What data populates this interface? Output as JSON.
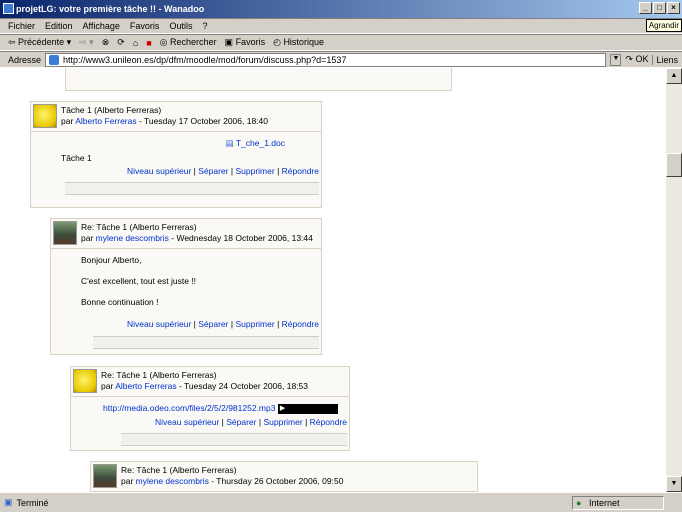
{
  "window": {
    "title": "projetLG: votre première tâche !! - Wanadoo",
    "tooltip": "Agrandir"
  },
  "menu": [
    "Fichier",
    "Edition",
    "Affichage",
    "Favoris",
    "Outils",
    "?"
  ],
  "toolbar": {
    "back": "Précédente",
    "search": "Rechercher",
    "favorites": "Favoris",
    "history": "Historique"
  },
  "address": {
    "label": "Adresse",
    "url": "http://www3.unileon.es/dp/dfm/moodle/mod/forum/discuss.php?d=1537",
    "go": "OK",
    "links": "Liens"
  },
  "status": {
    "text": "Terminé",
    "zone": "Internet"
  },
  "actions": {
    "parent": "Niveau supérieur",
    "split": "Séparer",
    "delete": "Supprimer",
    "reply": "Répondre",
    "sep": "|"
  },
  "posts": [
    {
      "subject": "Tâche 1 (Alberto Ferreras)",
      "by": "par",
      "author": "Alberto Ferreras",
      "date": " - Tuesday 17 October 2006, 18:40",
      "attachment": "T_che_1.doc",
      "body": [
        "Tâche 1"
      ]
    },
    {
      "subject": "Re: Tâche 1 (Alberto Ferreras)",
      "by": "par",
      "author": "mylene descombris",
      "date": " - Wednesday 18 October 2006, 13:44",
      "body": [
        "Bonjour Alberto,",
        "C'est excellent, tout est juste !!",
        "Bonne continuation !"
      ]
    },
    {
      "subject": "Re: Tâche 1 (Alberto Ferreras)",
      "by": "par",
      "author": "Alberto Ferreras",
      "date": " - Tuesday 24 October 2006, 18:53",
      "link": "http://media.odeo.com/files/2/5/2/981252.mp3"
    },
    {
      "subject": "Re: Tâche 1 (Alberto Ferreras)",
      "by": "par",
      "author": "mylene descombris",
      "date": " - Thursday 26 October 2006, 09:50"
    }
  ]
}
